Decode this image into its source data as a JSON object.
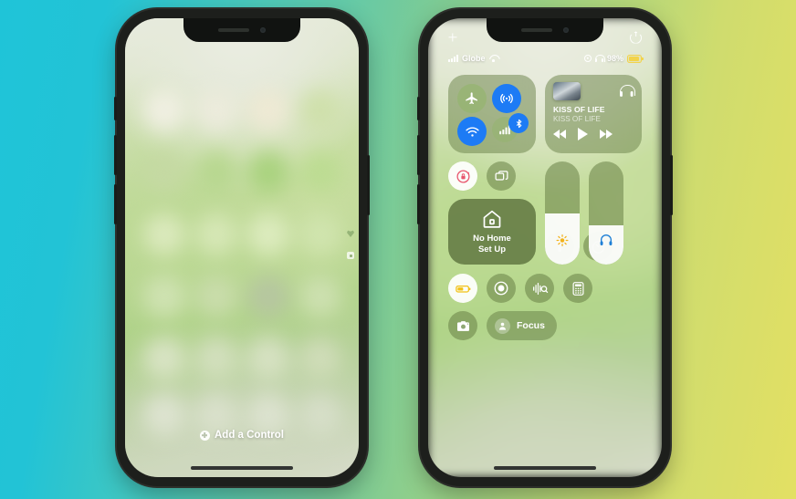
{
  "background": {
    "from": "#22c3d6",
    "mid": "#7ecb94",
    "to": "#e3e063"
  },
  "left_phone": {
    "name": "iphone-home-screen-blurred",
    "add_control": {
      "label": "Add a Control",
      "icon": "plus-circle-icon"
    },
    "page_indicators": [
      "heart-icon",
      "page-dot"
    ]
  },
  "right_phone": {
    "name": "iphone-control-center",
    "top_bar": {
      "left_icon": "sparkle-icon",
      "right_icon": "power-icon"
    },
    "status_bar": {
      "carrier": "Globe",
      "signal_icon": "cellular-bars-icon",
      "wifi_icon": "wifi-icon",
      "location_icon": "location-arrow-icon",
      "headphones_icon": "headphones-icon",
      "battery_percent": "98%",
      "battery_icon": "battery-icon"
    },
    "connectivity": {
      "name": "connectivity-module",
      "airplane": {
        "label": "Airplane Mode",
        "icon": "airplane-icon",
        "state": "off",
        "color": "#96b470"
      },
      "airdrop": {
        "label": "AirDrop",
        "icon": "airdrop-icon",
        "state": "on",
        "color": "#1d7bf5"
      },
      "wifi": {
        "label": "Wi-Fi",
        "icon": "wifi-icon",
        "state": "on",
        "color": "#1d7bf5"
      },
      "cellular": {
        "label": "Cellular Data",
        "icon": "cellular-bars-icon",
        "state": "off",
        "color": "#96b470"
      },
      "bluetooth": {
        "label": "Bluetooth",
        "icon": "bluetooth-icon",
        "state": "on",
        "color": "#1d7bf5"
      }
    },
    "media": {
      "name": "now-playing-module",
      "title": "KISS OF LIFE",
      "artist": "KISS OF LIFE",
      "artwork": "album-art",
      "output_icon": "headphones-icon",
      "previous": "rewind-icon",
      "play": "play-icon",
      "next": "fast-forward-icon"
    },
    "rotation_lock": {
      "label": "Rotation Lock",
      "icon": "rotation-lock-icon",
      "state": "on"
    },
    "screen_mirroring": {
      "label": "Screen Mirroring",
      "icon": "screen-mirroring-icon",
      "state": "off"
    },
    "home": {
      "label_line1": "No Home",
      "label_line2": "Set Up",
      "icon": "home-icon"
    },
    "brightness": {
      "label": "Brightness",
      "icon": "sun-icon",
      "value": 50
    },
    "volume": {
      "label": "Volume",
      "icon": "headphones-icon",
      "value": 38
    },
    "flashlight": {
      "label": "Flashlight",
      "icon": "flashlight-icon",
      "state": "off"
    },
    "timer": {
      "label": "Timer",
      "icon": "timer-icon",
      "state": "off"
    },
    "low_power": {
      "label": "Low Power Mode",
      "icon": "battery-icon",
      "state": "on"
    },
    "screen_record": {
      "label": "Screen Recording",
      "icon": "record-icon",
      "state": "off"
    },
    "sound_recognition": {
      "label": "Sound Recognition",
      "icon": "shazam-wave-icon",
      "state": "off"
    },
    "calculator": {
      "label": "Calculator",
      "icon": "calculator-icon",
      "state": "off"
    },
    "camera": {
      "label": "Camera",
      "icon": "camera-icon",
      "state": "off"
    },
    "focus": {
      "label": "Focus",
      "icon": "person-icon",
      "state": "off"
    }
  }
}
